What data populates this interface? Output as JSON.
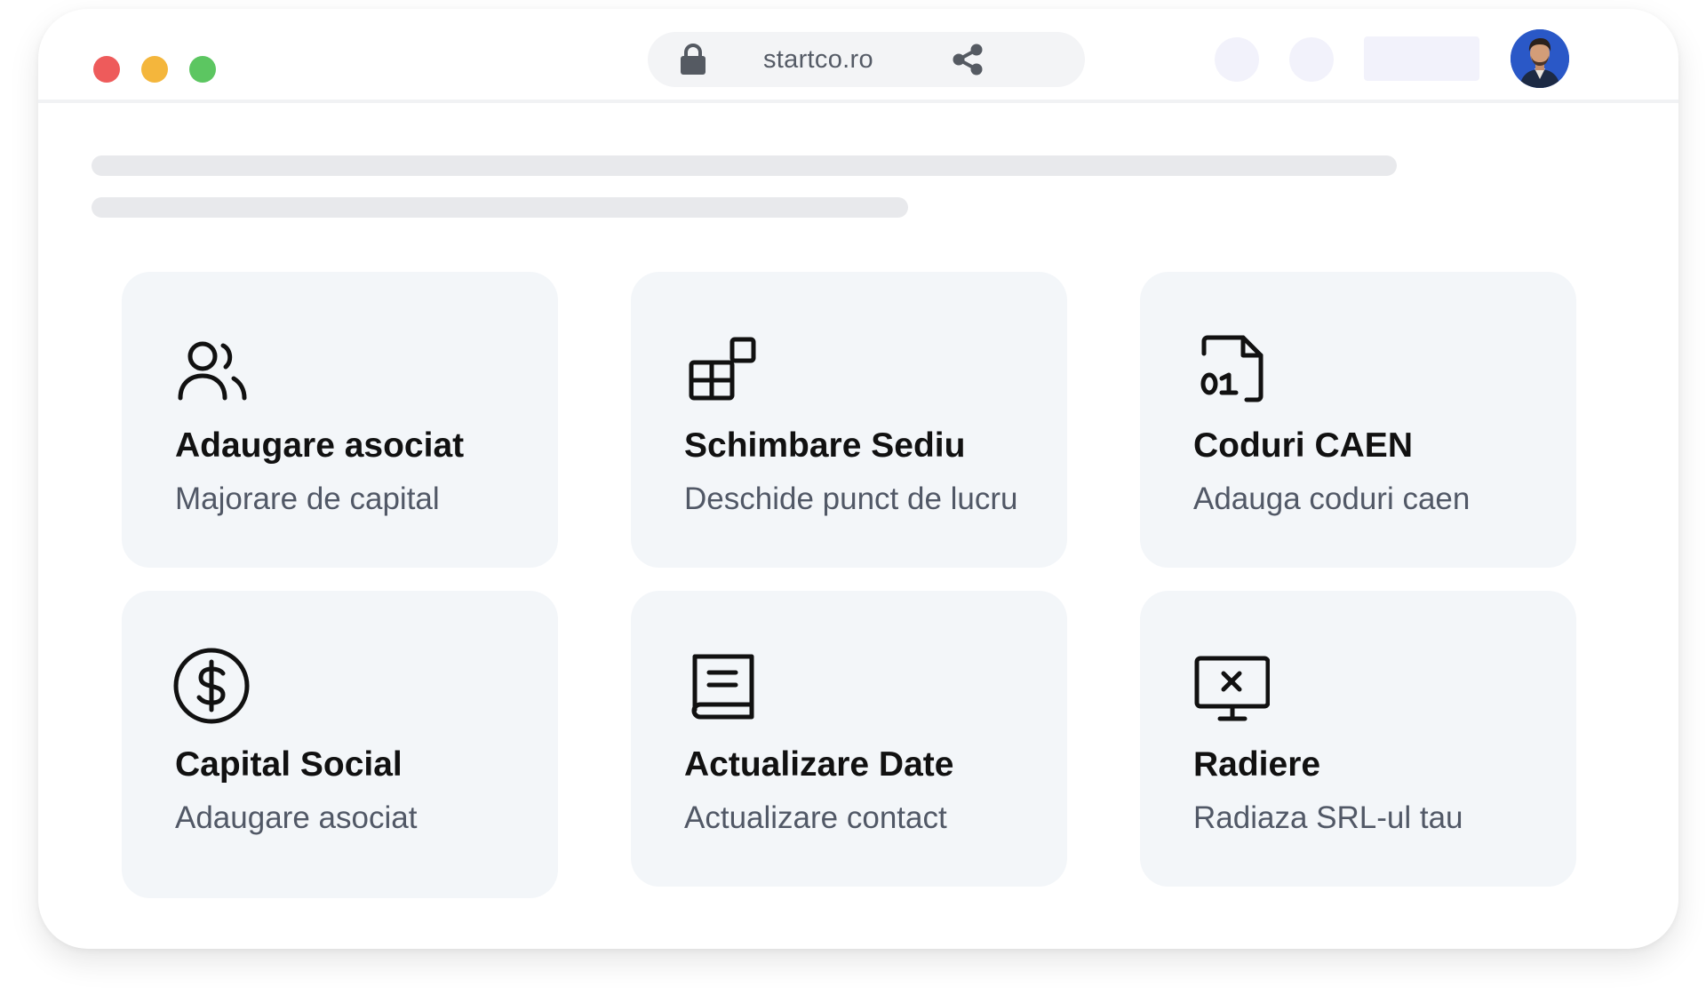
{
  "colors": {
    "traffic_red": "#ee5b5b",
    "traffic_yellow": "#f4b63c",
    "traffic_green": "#5cc661",
    "card_bg": "#f3f6f9",
    "skeleton": "#e8e9ec",
    "placeholder": "#f2f2fb",
    "avatar_bg": "#2a58c7"
  },
  "address_bar": {
    "url": "startco.ro",
    "lock_icon": "lock-icon",
    "share_icon": "share-icon"
  },
  "cards": [
    {
      "title": "Adaugare asociat",
      "subtitle": "Majorare de capital",
      "icon": "users-icon"
    },
    {
      "title": "Schimbare Sediu",
      "subtitle": "Deschide punct de lucru",
      "icon": "blocks-icon"
    },
    {
      "title": "Coduri CAEN",
      "subtitle": "Adauga coduri caen",
      "icon": "binary-file-icon"
    },
    {
      "title": "Capital Social",
      "subtitle": "Adaugare asociat",
      "icon": "dollar-circle-icon"
    },
    {
      "title": "Actualizare Date",
      "subtitle": "Actualizare contact",
      "icon": "book-icon"
    },
    {
      "title": "Radiere",
      "subtitle": "Radiaza SRL-ul tau",
      "icon": "monitor-x-icon"
    }
  ]
}
